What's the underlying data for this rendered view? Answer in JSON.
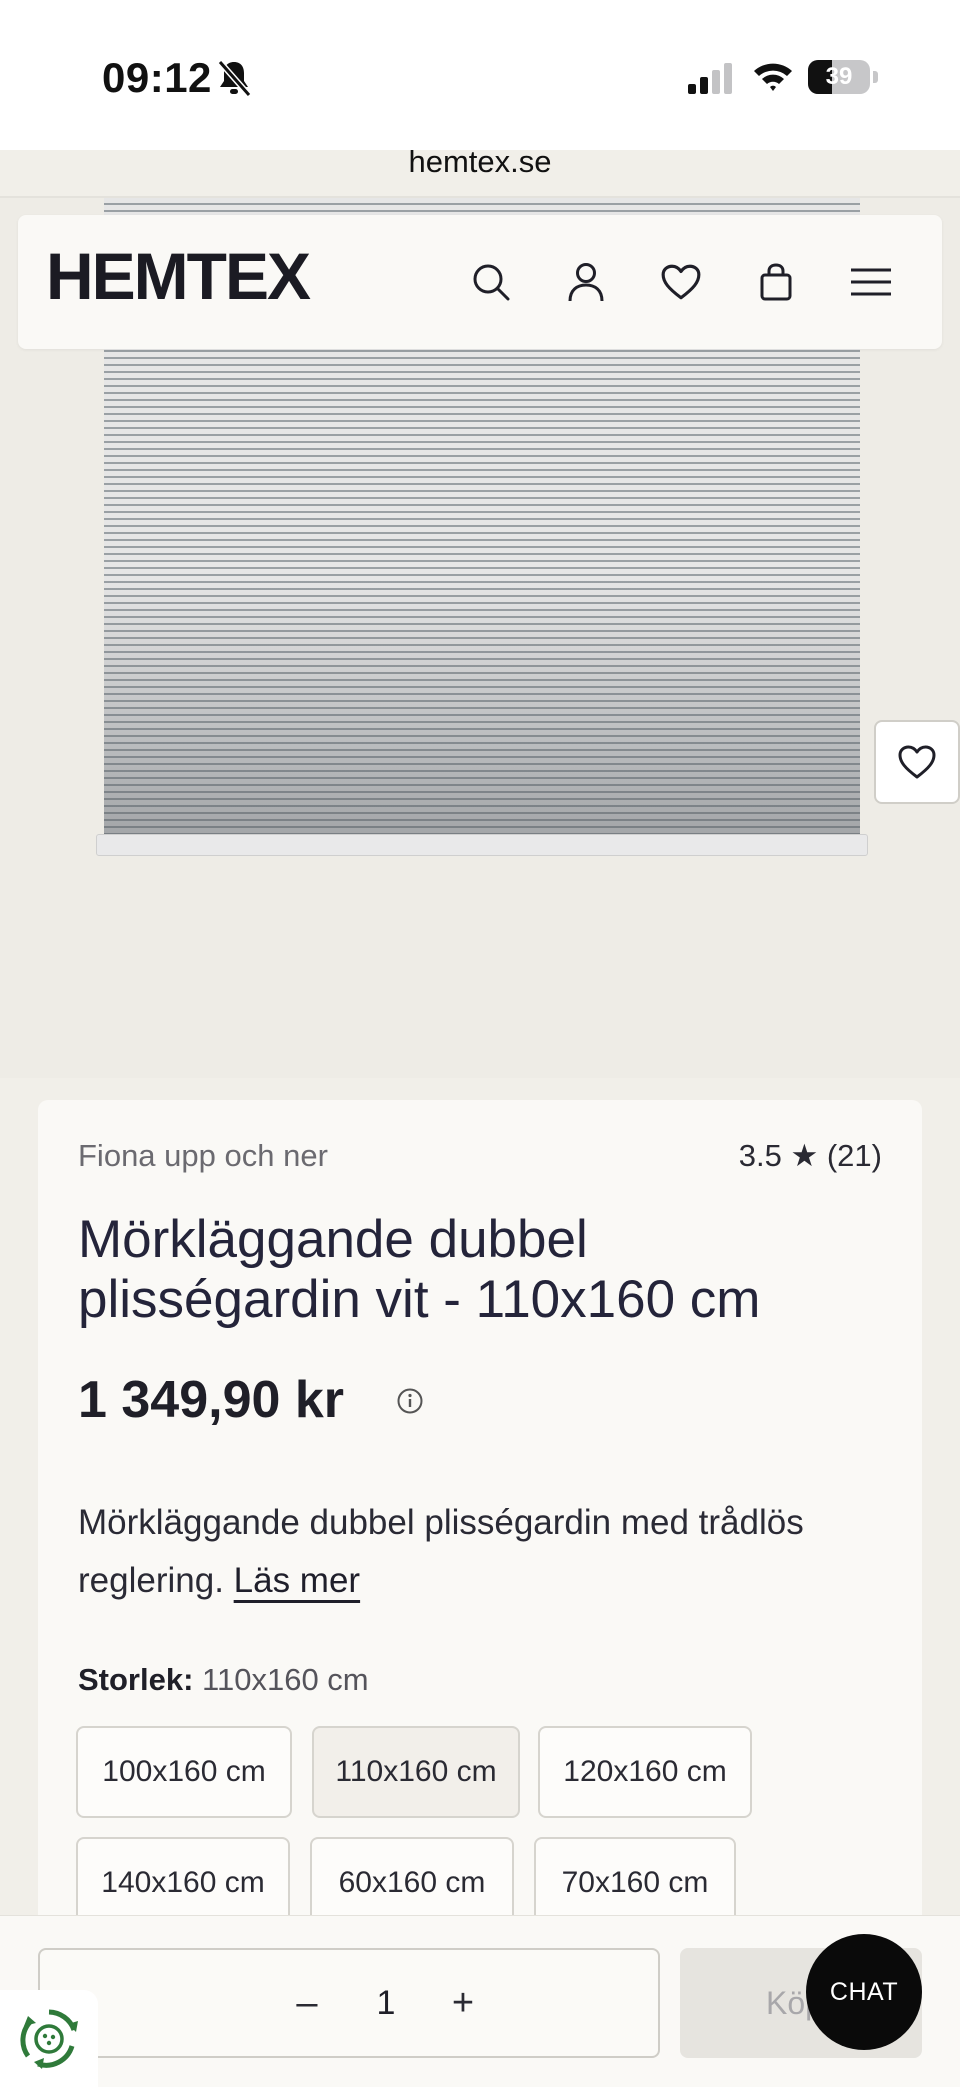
{
  "status_bar": {
    "time": "09:12",
    "battery": "39",
    "battery_level": 0.39
  },
  "browser": {
    "url": "hemtex.se"
  },
  "header": {
    "logo": "HEMTEX",
    "icons": [
      "search-icon",
      "account-icon",
      "wishlist-icon",
      "cart-icon",
      "menu-icon"
    ]
  },
  "product": {
    "brand": "Fiona upp och ner",
    "rating": "3.5 ★ (21)",
    "title": "Mörkläggande dubbel plisségardin vit - 110x160 cm",
    "price": "1 349,90 kr",
    "description": "Mörkläggande dubbel plisségardin med trådlös reglering.",
    "read_more": "Läs mer",
    "size_label": "Storlek:",
    "size_value": "110x160 cm",
    "sizes": [
      {
        "label": "100x160 cm",
        "selected": false
      },
      {
        "label": "110x160 cm",
        "selected": true
      },
      {
        "label": "120x160 cm",
        "selected": false
      },
      {
        "label": "140x160 cm",
        "selected": false
      },
      {
        "label": "60x160 cm",
        "selected": false
      },
      {
        "label": "70x160 cm",
        "selected": false
      }
    ]
  },
  "purchase": {
    "minus": "–",
    "quantity": "1",
    "plus": "+",
    "buy_label": "Köp"
  },
  "chat": {
    "label": "CHAT"
  },
  "colors": {
    "background": "#f1efe9",
    "card": "#faf9f6",
    "text": "#1f1f2b",
    "chat": "#0a0a0a"
  }
}
